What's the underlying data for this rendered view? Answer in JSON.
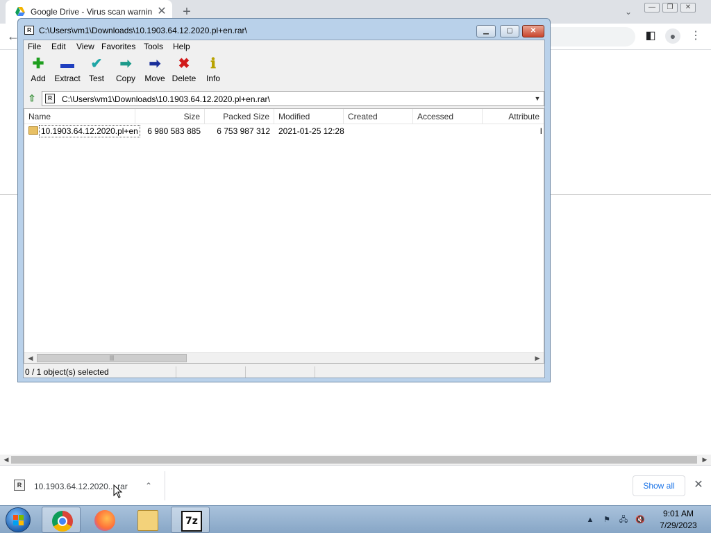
{
  "browser": {
    "tab_title": "Google Drive - Virus scan warnin",
    "tab_close": "✕",
    "new_tab": "+",
    "tab_menu": "⌄"
  },
  "page": {
    "scroll_left": "◀",
    "scroll_right": "▶"
  },
  "download_bar": {
    "file_name": "10.1903.64.12.2020....rar",
    "file_icon": "R",
    "show_all_label": "Show all",
    "close": "✕"
  },
  "zip_window": {
    "title": "C:\\Users\\vm1\\Downloads\\10.1903.64.12.2020.pl+en.rar\\",
    "title_icon": "R",
    "menu": [
      "File",
      "Edit",
      "View",
      "Favorites",
      "Tools",
      "Help"
    ],
    "toolbar": [
      {
        "label": "Add",
        "icon": "plus-icon",
        "glyph": "✚",
        "color": "#1e9e1e"
      },
      {
        "label": "Extract",
        "icon": "minus-icon",
        "glyph": "▬",
        "color": "#1f3fbf"
      },
      {
        "label": "Test",
        "icon": "check-icon",
        "glyph": "✔",
        "color": "#1fa6a6"
      },
      {
        "label": "Copy",
        "icon": "copy-arrow-icon",
        "glyph": "➡",
        "color": "#1b9a8a"
      },
      {
        "label": "Move",
        "icon": "move-arrow-icon",
        "glyph": "➡",
        "color": "#1a2f9a"
      },
      {
        "label": "Delete",
        "icon": "delete-x-icon",
        "glyph": "✖",
        "color": "#d11a1a"
      },
      {
        "label": "Info",
        "icon": "info-icon",
        "glyph": "ℹ",
        "color": "#b8a200"
      }
    ],
    "address": "C:\\Users\\vm1\\Downloads\\10.1903.64.12.2020.pl+en.rar\\",
    "address_icon": "R",
    "columns": [
      "Name",
      "Size",
      "Packed Size",
      "Modified",
      "Created",
      "Accessed",
      "Attribute"
    ],
    "rows": [
      {
        "name": "10.1903.64.12.2020.pl+en",
        "size": "6 980 583 885",
        "packed_size": "6 753 987 312",
        "modified": "2021-01-25 12:28",
        "created": "",
        "accessed": "",
        "attributes": "I"
      }
    ],
    "status": "0 / 1 object(s) selected"
  },
  "taskbar": {
    "apps": [
      "chrome-icon",
      "firefox-icon",
      "file-explorer-icon",
      "7zip-icon"
    ],
    "sevenz_label": "7z",
    "time": "9:01 AM",
    "date": "7/29/2023"
  }
}
